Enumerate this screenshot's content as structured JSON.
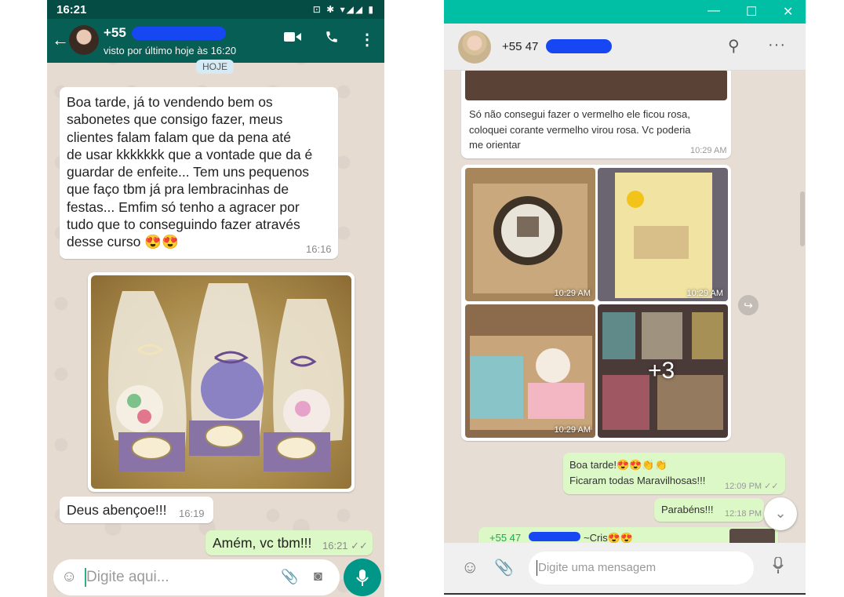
{
  "left_phone": {
    "status_time": "16:21",
    "contact_name": "+55",
    "last_seen": "visto por último hoje às 16:20",
    "day_chip": "HOJE",
    "messages": [
      {
        "direction": "in",
        "text": "Boa tarde, já to vendendo bem os\nsabonetes que consigo fazer, meus\nclientes falam falam que da pena até\nde usar kkkkkkk que a vontade que da é\nguardar de enfeite... Tem uns pequenos\nque faço tbm já pra lembracinhas de\nfestas... Emfim só tenho a agracer por\ntudo que to conseguindo fazer através\ndesse curso 😍😍",
        "time": "16:16"
      },
      {
        "direction": "in",
        "text": "Deus abençoe!!!",
        "time": "16:19"
      },
      {
        "direction": "out",
        "text": "Amém, vc tbm!!!",
        "time": "16:21 ✓✓"
      }
    ],
    "composer_placeholder": "Digite aqui..."
  },
  "right_window": {
    "contact_name": "+55 47",
    "window_controls": [
      "—",
      "☐",
      "✕"
    ],
    "caption_message": {
      "text": "Só não consegui fazer o vermelho ele ficou rosa,\ncoloquei corante vermelho virou rosa. Vc poderia\nme orientar",
      "time": "10:29 AM"
    },
    "photo_tiles": [
      {
        "time": "10:29 AM"
      },
      {
        "time": "10:29 AM"
      },
      {
        "time": "10:29 AM"
      },
      {
        "more": "+3"
      }
    ],
    "out_messages": [
      {
        "text": "Boa tarde!😍😍👏👏\nFicaram todas Maravilhosas!!!",
        "time": "12:09 PM ✓✓"
      },
      {
        "text": "Parabéns!!!",
        "time": "12:18 PM"
      }
    ],
    "partial_message": {
      "sender": "+55 47",
      "tail": "~Cris😍😍"
    },
    "composer_placeholder": "Digite uma mensagem"
  }
}
